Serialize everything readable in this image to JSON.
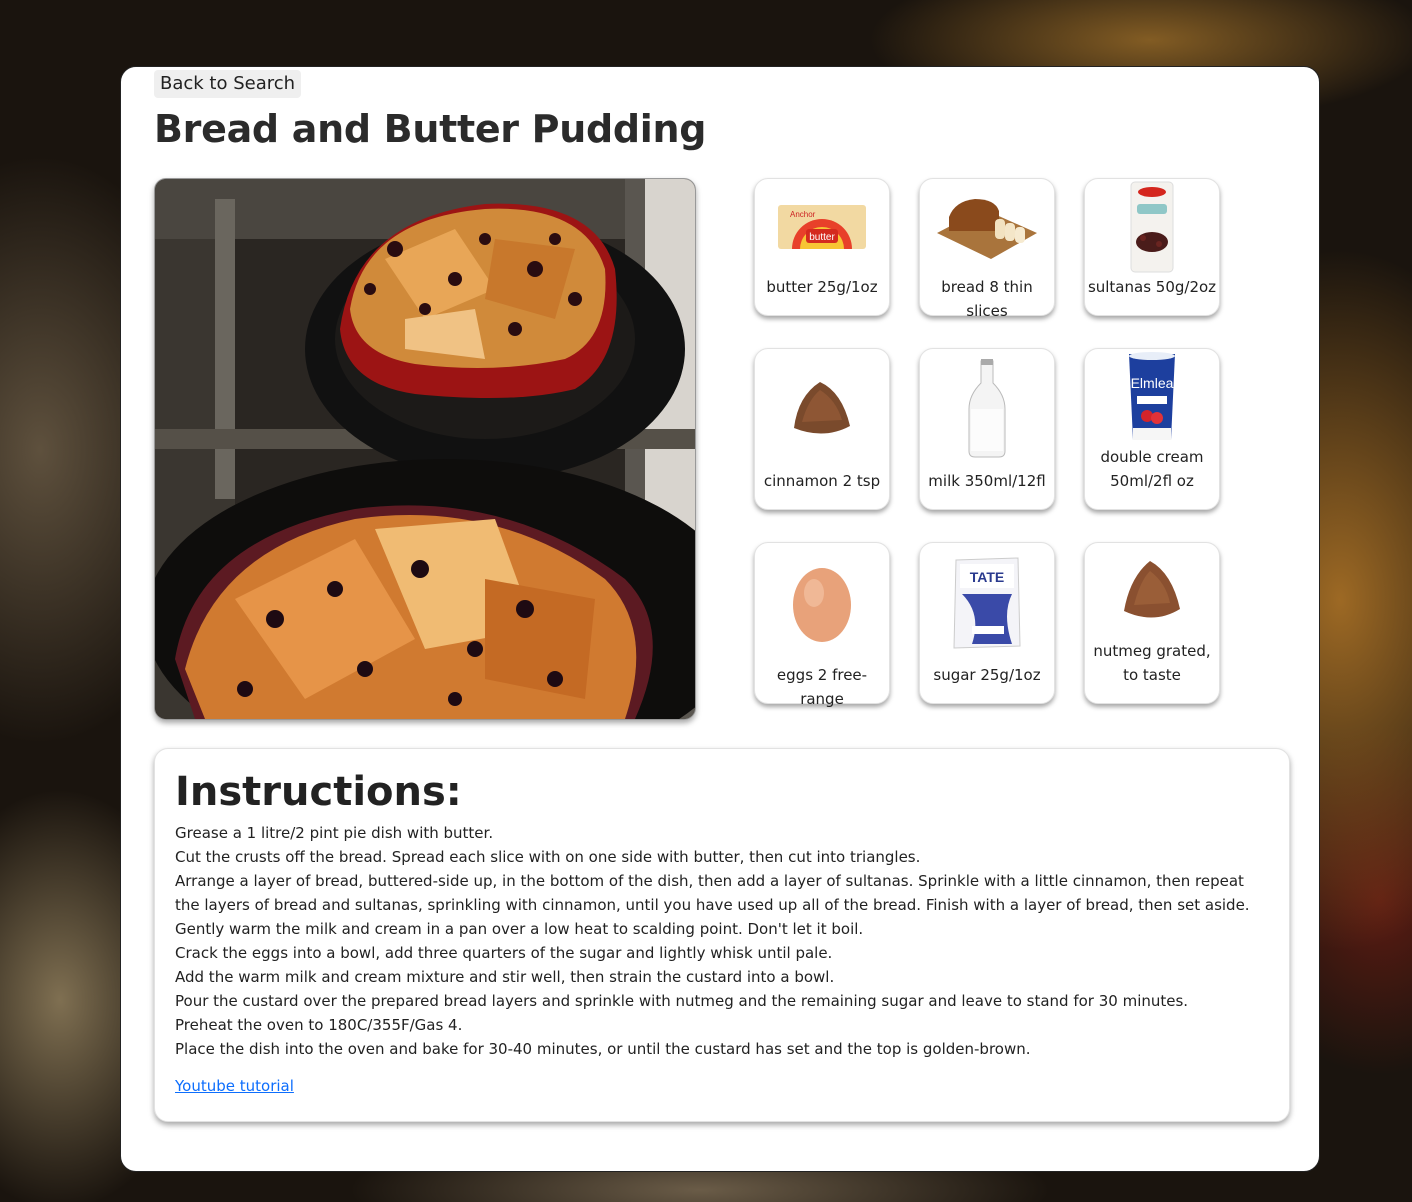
{
  "nav": {
    "back_label": "Back to Search"
  },
  "recipe": {
    "title": "Bread and Butter Pudding",
    "image_alt": "Bread and Butter Pudding"
  },
  "ingredients": [
    {
      "label": "butter 25g/1oz",
      "icon": "butter-pack-icon"
    },
    {
      "label": "bread 8 thin slices",
      "icon": "bread-loaf-icon"
    },
    {
      "label": "sultanas 50g/2oz",
      "icon": "sultanas-bag-icon"
    },
    {
      "label": "cinnamon 2 tsp",
      "icon": "spice-pile-icon"
    },
    {
      "label": "milk 350ml/12fl",
      "icon": "milk-bottle-icon"
    },
    {
      "label": "double cream 50ml/2fl oz",
      "icon": "cream-tub-icon"
    },
    {
      "label": "eggs 2 free-range",
      "icon": "egg-icon"
    },
    {
      "label": "sugar 25g/1oz",
      "icon": "sugar-bag-icon"
    },
    {
      "label": "nutmeg grated, to taste",
      "icon": "spice-pile-icon"
    }
  ],
  "instructions": {
    "heading": "Instructions:",
    "steps": [
      "Grease a 1 litre/2 pint pie dish with butter.",
      "Cut the crusts off the bread. Spread each slice with on one side with butter, then cut into triangles.",
      "Arrange a layer of bread, buttered-side up, in the bottom of the dish, then add a layer of sultanas. Sprinkle with a little cinnamon, then repeat the layers of bread and sultanas, sprinkling with cinnamon, until you have used up all of the bread. Finish with a layer of bread, then set aside.",
      "Gently warm the milk and cream in a pan over a low heat to scalding point. Don't let it boil.",
      "Crack the eggs into a bowl, add three quarters of the sugar and lightly whisk until pale.",
      "Add the warm milk and cream mixture and stir well, then strain the custard into a bowl.",
      "Pour the custard over the prepared bread layers and sprinkle with nutmeg and the remaining sugar and leave to stand for 30 minutes.",
      "Preheat the oven to 180C/355F/Gas 4.",
      "Place the dish into the oven and bake for 30-40 minutes, or until the custard has set and the top is golden-brown."
    ],
    "link_label": "Youtube tutorial"
  }
}
